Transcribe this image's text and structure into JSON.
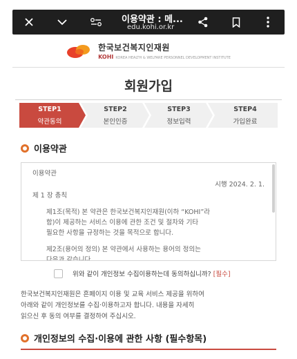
{
  "browser": {
    "title": "이용약관 : 메...",
    "url": "edu.kohi.or.kr"
  },
  "logo": {
    "name_ko": "한국보건복지인재원",
    "name_en": "KOHI",
    "subtitle": "KOREA HEALTH & WELFARE PERSONNEL DEVELOPMENT INSTITUTE"
  },
  "page_title": "회원가입",
  "steps": [
    {
      "num": "STEP1",
      "label": "약관동의"
    },
    {
      "num": "STEP2",
      "label": "본인인증"
    },
    {
      "num": "STEP3",
      "label": "정보입력"
    },
    {
      "num": "STEP4",
      "label": "가입완료"
    }
  ],
  "terms_section": {
    "heading": "이용약관",
    "box_title": "이용약관",
    "effective": "시행 2024. 2. 1.",
    "chapter": "제 1 장 총칙",
    "article1_line1": "제1조(목적) 본 약관은 한국보건복지인재원(이하 “KOHI”라",
    "article1_line2": "함)이 제공하는 서비스 이용에 관한 조건 및 절차와 기타",
    "article1_line3": "필요한 사항을 규정하는 것을 목적으로 합니다.",
    "article2_line1": "제2조(용어의 정의) 본 약관에서 사용하는 용어의 정의는",
    "article2_line2": "다음과 같습니다."
  },
  "agree": {
    "text": "위와 같이 개인정보 수집이용하는데 동의하십니까?",
    "required": "[필수]"
  },
  "notice": {
    "line1": "한국보건복지인재원은 흔페이지 이용 및 교육 서비스 제공을 위하여",
    "line2": "아래와 같이 개인정보를 수집·이용하고자 합니다. 내용을 자세히",
    "line3": "읽으신 후 동의 여부를 결정하여 주십시오."
  },
  "privacy_heading": "개인정보의 수집·이용에 관한 사항 (필수항목)",
  "colors": {
    "accent": "#c94a3f",
    "bullet": "#e1712b",
    "step_inactive": "#f0f0f0",
    "toolbar": "#1f1f1f"
  },
  "icons": {
    "close": "close-icon",
    "chevron": "chevron-down-icon",
    "site_settings": "site-settings-icon",
    "share": "share-icon",
    "bookmark": "bookmark-icon",
    "menu": "more-vert-icon"
  }
}
